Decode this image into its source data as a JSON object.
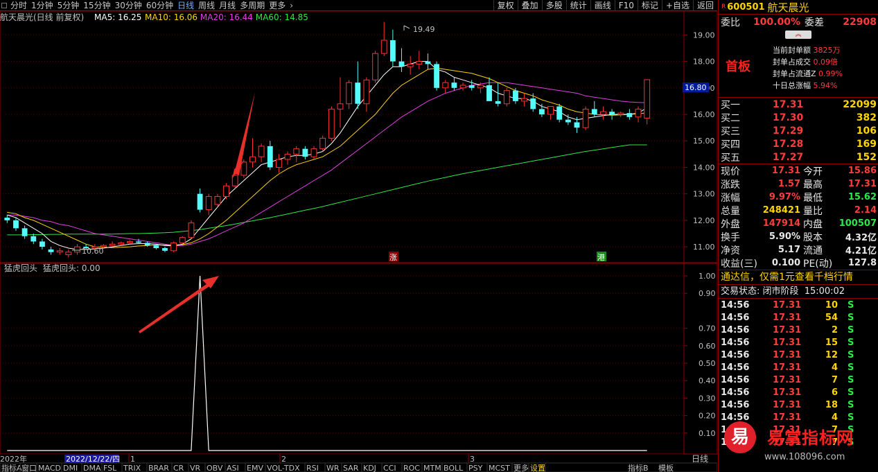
{
  "toolbar": {
    "periods": [
      "分时",
      "1分钟",
      "5分钟",
      "15分钟",
      "30分钟",
      "60分钟",
      "日线",
      "周线",
      "月线",
      "多周期",
      "更多"
    ],
    "active_period": "日线",
    "right_buttons": [
      "复权",
      "叠加",
      "多股",
      "统计",
      "画线",
      "F10",
      "标记",
      "+自选",
      "返回"
    ]
  },
  "chart_header": {
    "title": "航天晨光(日线 前复权)",
    "ma": [
      {
        "label": "MA5: 16.25",
        "color": "#ffffff"
      },
      {
        "label": "MA10: 16.06",
        "color": "#ffd400"
      },
      {
        "label": "MA20: 16.44",
        "color": "#e040e0"
      },
      {
        "label": "MA60: 14.85",
        "color": "#2ee84a"
      }
    ]
  },
  "price_axis": {
    "ticks": [
      "19.00",
      "18.00",
      "17.00",
      "16.00",
      "15.00",
      "14.00",
      "13.00",
      "12.00",
      "11.00"
    ],
    "current_price_label": "16.80"
  },
  "annotations": {
    "high": "19.49",
    "low": "10.60",
    "zhang_badge": "涨",
    "gang_badge": "港"
  },
  "indicator": {
    "title": "猛虎回头",
    "value_label": "猛虎回头: 0.00",
    "ticks": [
      "1.00",
      "0.90",
      "0.70",
      "0.60",
      "0.50",
      "0.40",
      "0.30",
      "0.20",
      "0.10"
    ]
  },
  "date_axis": {
    "year": "2022年",
    "cursor_date": "2022/12/22/四",
    "months": [
      "1",
      "2",
      "3"
    ],
    "right_label": "日线"
  },
  "bottom_tabs": [
    "指标A",
    "窗口",
    "MACD",
    "DMI",
    "DMA",
    "FSL",
    "TRIX",
    "BRAR",
    "CR",
    "VR",
    "OBV",
    "ASI",
    "EMV",
    "VOL-TDX",
    "RSI",
    "WR",
    "SAR",
    "KDJ",
    "CCI",
    "ROC",
    "MTM",
    "BOLL",
    "PSY",
    "MCST",
    "更多",
    "设置"
  ],
  "bottom_right_tabs": [
    "指标B",
    "模板"
  ],
  "quote": {
    "code": "600501",
    "name": "航天晨光",
    "weibi_label": "委比",
    "weibi": "100.00%",
    "weicha_label": "委差",
    "weicha": "22908",
    "status": "首板",
    "seal_info": [
      {
        "label": "当前封单额",
        "value": "3825万"
      },
      {
        "label": "封单占成交",
        "value": "0.09倍"
      },
      {
        "label": "封单占流通Z",
        "value": "0.99%"
      },
      {
        "label": "十日总涨幅",
        "value": "5.94%"
      }
    ],
    "bids": [
      {
        "label": "买一",
        "price": "17.31",
        "vol": "22099"
      },
      {
        "label": "买二",
        "price": "17.30",
        "vol": "382"
      },
      {
        "label": "买三",
        "price": "17.29",
        "vol": "106"
      },
      {
        "label": "买四",
        "price": "17.28",
        "vol": "169"
      },
      {
        "label": "买五",
        "price": "17.27",
        "vol": "152"
      }
    ],
    "stats": [
      {
        "l1": "现价",
        "v1": "17.31",
        "l2": "今开",
        "v2": "15.86"
      },
      {
        "l1": "涨跌",
        "v1": "1.57",
        "l2": "最高",
        "v2": "17.31"
      },
      {
        "l1": "涨幅",
        "v1": "9.97%",
        "l2": "最低",
        "v2": "15.62"
      },
      {
        "l1": "总量",
        "v1": "248421",
        "l2": "量比",
        "v2": "2.14"
      },
      {
        "l1": "外盘",
        "v1": "147914",
        "l2": "内盘",
        "v2": "100507"
      },
      {
        "l1": "换手",
        "v1": "5.90%",
        "l2": "股本",
        "v2": "4.32亿"
      },
      {
        "l1": "净资",
        "v1": "5.17",
        "l2": "流通",
        "v2": "4.21亿"
      },
      {
        "l1": "收益(三)",
        "v1": "0.100",
        "l2": "PE(动)",
        "v2": "127.8"
      }
    ],
    "promo": "通达信，仅需1元查看千档行情",
    "trade_status_label": "交易状态:",
    "trade_status": "闭市阶段",
    "trade_time": "15:00:02",
    "ticks": [
      {
        "time": "14:56",
        "price": "17.31",
        "vol": "10",
        "side": "S"
      },
      {
        "time": "14:56",
        "price": "17.31",
        "vol": "54",
        "side": "S"
      },
      {
        "time": "14:56",
        "price": "17.31",
        "vol": "2",
        "side": "S"
      },
      {
        "time": "14:56",
        "price": "17.31",
        "vol": "15",
        "side": "S"
      },
      {
        "time": "14:56",
        "price": "17.31",
        "vol": "12",
        "side": "S"
      },
      {
        "time": "14:56",
        "price": "17.31",
        "vol": "4",
        "side": "S"
      },
      {
        "time": "14:56",
        "price": "17.31",
        "vol": "7",
        "side": "S"
      },
      {
        "time": "14:56",
        "price": "17.31",
        "vol": "6",
        "side": "S"
      },
      {
        "time": "14:56",
        "price": "17.31",
        "vol": "18",
        "side": "S"
      },
      {
        "time": "14:56",
        "price": "17.31",
        "vol": "4",
        "side": "S"
      },
      {
        "time": "14:56",
        "price": "17.31",
        "vol": "7",
        "side": "S"
      },
      {
        "time": "14:56",
        "price": "17.31",
        "vol": "7",
        "side": "S"
      }
    ]
  },
  "watermark": {
    "title": "易掌指标网",
    "url": "www.108096.com",
    "logo_char": "易"
  },
  "chart_data": {
    "type": "candlestick",
    "candles": [
      [
        12.1,
        12.2,
        11.9,
        12.0
      ],
      [
        12.0,
        12.1,
        11.6,
        11.7
      ],
      [
        11.7,
        11.8,
        11.3,
        11.4
      ],
      [
        11.4,
        11.5,
        11.1,
        11.2
      ],
      [
        11.2,
        11.3,
        10.9,
        11.0
      ],
      [
        10.9,
        11.0,
        10.7,
        10.8
      ],
      [
        10.8,
        10.95,
        10.7,
        10.85
      ],
      [
        10.7,
        10.9,
        10.6,
        10.8
      ],
      [
        10.8,
        11.1,
        10.7,
        11.0
      ],
      [
        11.0,
        11.1,
        10.9,
        10.95
      ],
      [
        10.95,
        11.1,
        10.9,
        11.0
      ],
      [
        11.0,
        11.1,
        10.95,
        11.05
      ],
      [
        11.05,
        11.2,
        11.0,
        11.1
      ],
      [
        11.1,
        11.2,
        11.05,
        11.15
      ],
      [
        11.15,
        11.25,
        11.1,
        11.2
      ],
      [
        11.2,
        11.3,
        11.1,
        11.15
      ],
      [
        11.15,
        11.2,
        11.0,
        11.05
      ],
      [
        11.05,
        11.1,
        10.9,
        10.95
      ],
      [
        10.95,
        11.0,
        10.8,
        10.85
      ],
      [
        10.85,
        11.2,
        10.8,
        11.15
      ],
      [
        11.15,
        11.4,
        11.1,
        11.35
      ],
      [
        11.35,
        12.0,
        11.3,
        11.9
      ],
      [
        13.0,
        13.2,
        12.3,
        12.4
      ],
      [
        12.4,
        13.0,
        12.2,
        12.9
      ],
      [
        12.6,
        13.0,
        12.5,
        12.9
      ],
      [
        12.9,
        13.4,
        12.8,
        13.3
      ],
      [
        13.3,
        13.8,
        13.2,
        13.7
      ],
      [
        13.7,
        14.3,
        13.6,
        14.2
      ],
      [
        14.2,
        15.1,
        14.0,
        14.4
      ],
      [
        14.4,
        14.9,
        14.2,
        14.8
      ],
      [
        14.8,
        15.0,
        13.9,
        14.0
      ],
      [
        14.0,
        14.5,
        13.8,
        14.3
      ],
      [
        14.3,
        14.6,
        14.1,
        14.5
      ],
      [
        14.5,
        14.8,
        14.2,
        14.7
      ],
      [
        14.7,
        14.8,
        14.3,
        14.4
      ],
      [
        14.4,
        14.8,
        14.3,
        14.7
      ],
      [
        14.7,
        15.2,
        14.6,
        15.1
      ],
      [
        15.1,
        16.3,
        15.0,
        16.2
      ],
      [
        16.2,
        17.4,
        15.5,
        16.4
      ],
      [
        16.4,
        17.3,
        16.2,
        17.2
      ],
      [
        17.2,
        18.0,
        16.2,
        16.4
      ],
      [
        16.4,
        17.4,
        16.1,
        17.3
      ],
      [
        17.3,
        18.4,
        17.2,
        18.3
      ],
      [
        18.3,
        19.49,
        18.2,
        18.8
      ],
      [
        18.8,
        19.2,
        17.8,
        18.0
      ],
      [
        18.0,
        18.5,
        17.6,
        17.8
      ],
      [
        17.8,
        18.2,
        17.5,
        17.9
      ],
      [
        17.9,
        18.4,
        17.7,
        18.0
      ],
      [
        18.0,
        18.3,
        17.7,
        17.9
      ],
      [
        17.9,
        18.0,
        16.9,
        17.0
      ],
      [
        17.0,
        17.3,
        16.8,
        17.2
      ],
      [
        17.2,
        17.4,
        16.9,
        17.0
      ],
      [
        17.0,
        17.2,
        16.9,
        17.1
      ],
      [
        17.1,
        17.3,
        16.9,
        17.0
      ],
      [
        17.0,
        17.2,
        16.8,
        17.1
      ],
      [
        17.1,
        17.4,
        16.8,
        16.5
      ],
      [
        16.5,
        17.2,
        16.3,
        16.4
      ],
      [
        16.4,
        17.0,
        16.3,
        16.9
      ],
      [
        16.9,
        17.0,
        16.4,
        16.5
      ],
      [
        16.5,
        16.8,
        16.3,
        16.6
      ],
      [
        16.6,
        16.8,
        16.1,
        16.2
      ],
      [
        16.2,
        16.4,
        15.9,
        16.0
      ],
      [
        16.0,
        16.2,
        15.8,
        16.3
      ],
      [
        16.3,
        16.4,
        15.7,
        15.8
      ],
      [
        15.8,
        16.0,
        15.6,
        15.7
      ],
      [
        15.7,
        15.9,
        15.3,
        15.5
      ],
      [
        15.5,
        16.3,
        15.4,
        16.2
      ],
      [
        16.2,
        16.5,
        15.9,
        16.0
      ],
      [
        16.0,
        16.3,
        15.8,
        16.1
      ],
      [
        16.1,
        16.2,
        15.8,
        16.0
      ],
      [
        16.0,
        16.1,
        15.9,
        16.05
      ],
      [
        16.05,
        16.2,
        15.8,
        15.9
      ],
      [
        15.9,
        16.3,
        15.7,
        16.2
      ],
      [
        15.86,
        17.31,
        15.62,
        17.31
      ]
    ],
    "ma5": [
      12.2,
      12.1,
      11.9,
      11.7,
      11.5,
      11.2,
      11.05,
      10.95,
      10.9,
      10.9,
      10.92,
      10.95,
      11.0,
      11.05,
      11.1,
      11.12,
      11.12,
      11.1,
      11.05,
      11.03,
      11.1,
      11.3,
      11.7,
      12.1,
      12.5,
      12.9,
      13.2,
      13.5,
      13.8,
      14.1,
      14.2,
      14.3,
      14.4,
      14.45,
      14.45,
      14.5,
      14.6,
      14.9,
      15.3,
      15.8,
      16.3,
      16.7,
      17.1,
      17.5,
      17.8,
      17.8,
      17.9,
      18.0,
      18.0,
      17.7,
      17.6,
      17.4,
      17.3,
      17.2,
      17.1,
      17.0,
      16.8,
      16.7,
      16.6,
      16.6,
      16.5,
      16.3,
      16.2,
      16.1,
      15.9,
      15.8,
      15.85,
      15.9,
      15.95,
      16.0,
      16.0,
      16.0,
      16.05,
      16.25
    ],
    "ma10": [
      12.3,
      12.25,
      12.1,
      12.0,
      11.85,
      11.7,
      11.55,
      11.4,
      11.25,
      11.1,
      11.0,
      10.98,
      10.97,
      10.98,
      11.0,
      11.03,
      11.05,
      11.07,
      11.07,
      11.07,
      11.08,
      11.15,
      11.3,
      11.5,
      11.75,
      12.0,
      12.3,
      12.6,
      12.9,
      13.2,
      13.5,
      13.75,
      13.95,
      14.1,
      14.2,
      14.3,
      14.4,
      14.6,
      14.8,
      15.1,
      15.4,
      15.7,
      16.0,
      16.4,
      16.8,
      17.1,
      17.3,
      17.5,
      17.7,
      17.75,
      17.7,
      17.65,
      17.6,
      17.55,
      17.45,
      17.35,
      17.2,
      17.05,
      16.9,
      16.8,
      16.7,
      16.55,
      16.45,
      16.35,
      16.2,
      16.1,
      16.05,
      16.0,
      15.98,
      15.97,
      15.98,
      16.0,
      16.02,
      16.06
    ],
    "ma20": [
      12.2,
      12.2,
      12.15,
      12.1,
      12.0,
      11.95,
      11.85,
      11.8,
      11.7,
      11.6,
      11.5,
      11.45,
      11.4,
      11.35,
      11.3,
      11.25,
      11.2,
      11.15,
      11.1,
      11.05,
      11.05,
      11.1,
      11.2,
      11.3,
      11.45,
      11.6,
      11.75,
      11.9,
      12.1,
      12.3,
      12.5,
      12.7,
      12.9,
      13.1,
      13.3,
      13.5,
      13.7,
      13.9,
      14.15,
      14.4,
      14.65,
      14.9,
      15.15,
      15.4,
      15.65,
      15.9,
      16.1,
      16.3,
      16.5,
      16.65,
      16.8,
      16.9,
      17.0,
      17.1,
      17.15,
      17.2,
      17.2,
      17.2,
      17.15,
      17.1,
      17.05,
      17.0,
      16.95,
      16.9,
      16.85,
      16.8,
      16.7,
      16.65,
      16.6,
      16.55,
      16.5,
      16.47,
      16.45,
      16.44
    ],
    "ma60": [
      11.45,
      11.45,
      11.45,
      11.46,
      11.46,
      11.47,
      11.47,
      11.48,
      11.48,
      11.48,
      11.48,
      11.48,
      11.48,
      11.49,
      11.5,
      11.5,
      11.51,
      11.52,
      11.53,
      11.55,
      11.58,
      11.61,
      11.65,
      11.7,
      11.75,
      11.8,
      11.86,
      11.92,
      11.98,
      12.04,
      12.1,
      12.17,
      12.24,
      12.31,
      12.38,
      12.45,
      12.52,
      12.6,
      12.68,
      12.76,
      12.84,
      12.92,
      13.0,
      13.08,
      13.16,
      13.24,
      13.32,
      13.4,
      13.48,
      13.55,
      13.62,
      13.69,
      13.76,
      13.82,
      13.88,
      13.94,
      14.0,
      14.06,
      14.12,
      14.18,
      14.24,
      14.3,
      14.36,
      14.42,
      14.48,
      14.54,
      14.6,
      14.65,
      14.7,
      14.75,
      14.8,
      14.85,
      14.85,
      14.85
    ],
    "indicator_signal_index": 22,
    "price_ylim": [
      10.4,
      19.9
    ],
    "indicator_ylim": [
      0,
      1.0
    ]
  }
}
